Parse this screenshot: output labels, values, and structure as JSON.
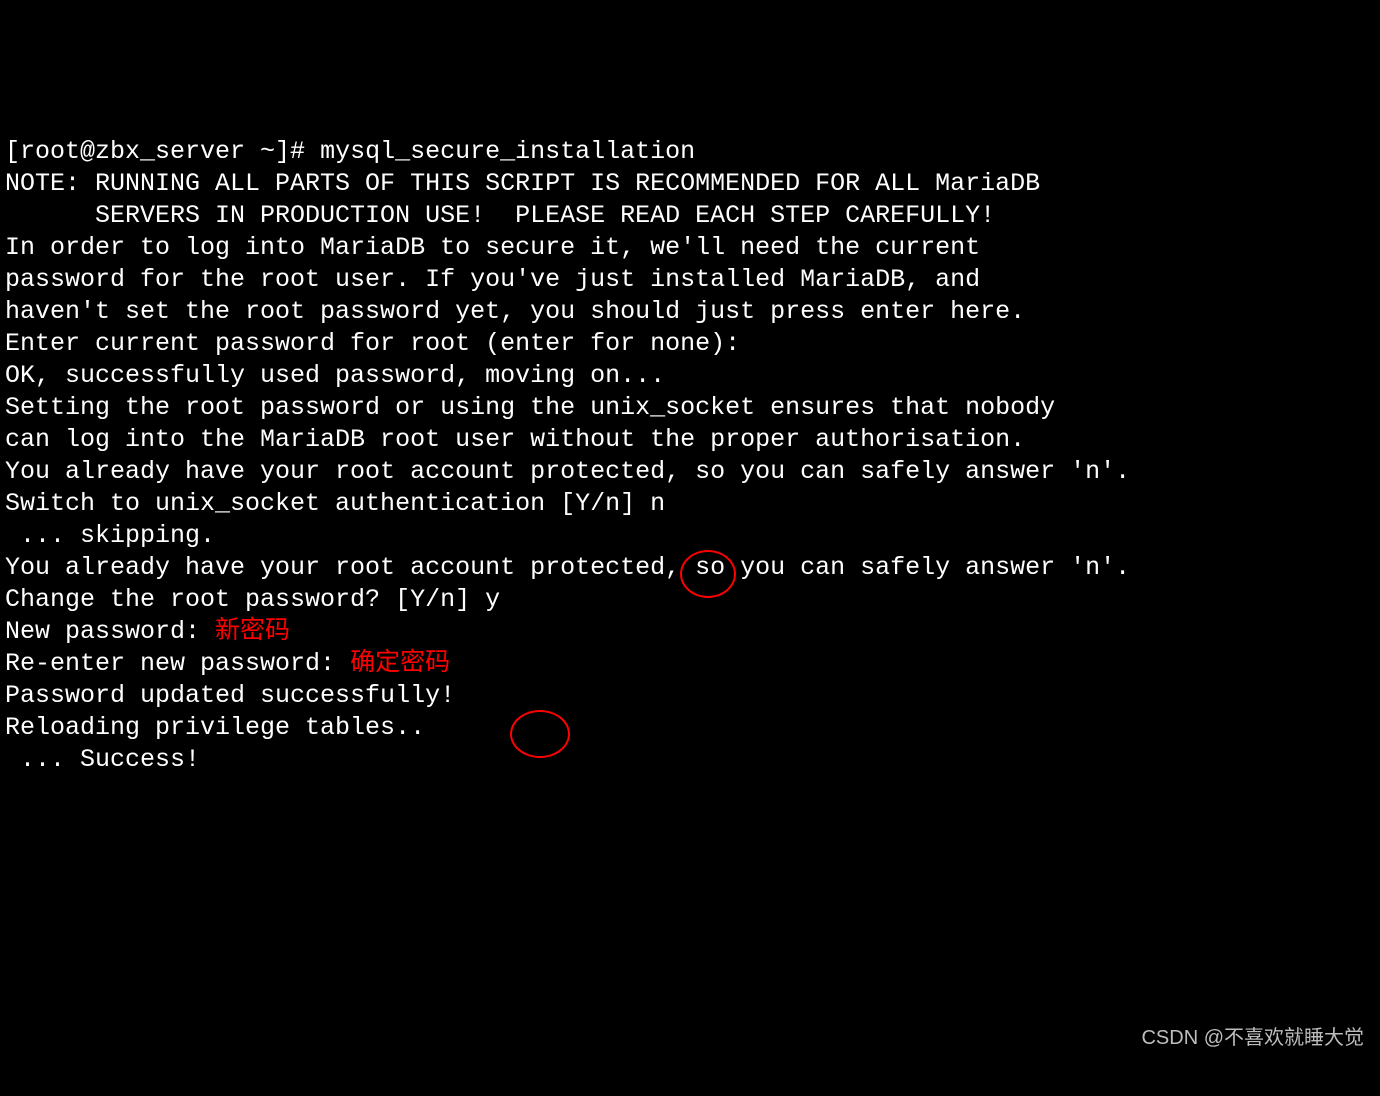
{
  "terminal": {
    "prompt": "[root@zbx_server ~]# ",
    "command": "mysql_secure_installation",
    "blank1": "",
    "note1": "NOTE: RUNNING ALL PARTS OF THIS SCRIPT IS RECOMMENDED FOR ALL MariaDB",
    "note2": "      SERVERS IN PRODUCTION USE!  PLEASE READ EACH STEP CAREFULLY!",
    "blank2": "",
    "intro1": "In order to log into MariaDB to secure it, we'll need the current",
    "intro2": "password for the root user. If you've just installed MariaDB, and",
    "intro3": "haven't set the root password yet, you should just press enter here.",
    "blank3": "",
    "enter_pw": "Enter current password for root (enter for none): ",
    "ok_pw": "OK, successfully used password, moving on...",
    "blank4": "",
    "setting1": "Setting the root password or using the unix_socket ensures that nobody",
    "setting2": "can log into the MariaDB root user without the proper authorisation.",
    "blank5": "",
    "already1": "You already have your root account protected, so you can safely answer 'n'.",
    "blank6": "",
    "switch_prompt": "Switch to unix_socket authentication [Y/n] ",
    "switch_input": "n",
    "skipping": " ... skipping.",
    "blank7": "",
    "already2": "You already have your root account protected, so you can safely answer 'n'.",
    "blank8": "",
    "change_prompt": "Change the root password? [Y/n] ",
    "change_input": "y",
    "new_pw_label": "New password: ",
    "new_pw_anno": "新密码",
    "reenter_label": "Re-enter new password: ",
    "reenter_anno": "确定密码",
    "updated": "Password updated successfully!",
    "reloading": "Reloading privilege tables..",
    "success": " ... Success!"
  },
  "watermark": "CSDN @不喜欢就睡大觉"
}
